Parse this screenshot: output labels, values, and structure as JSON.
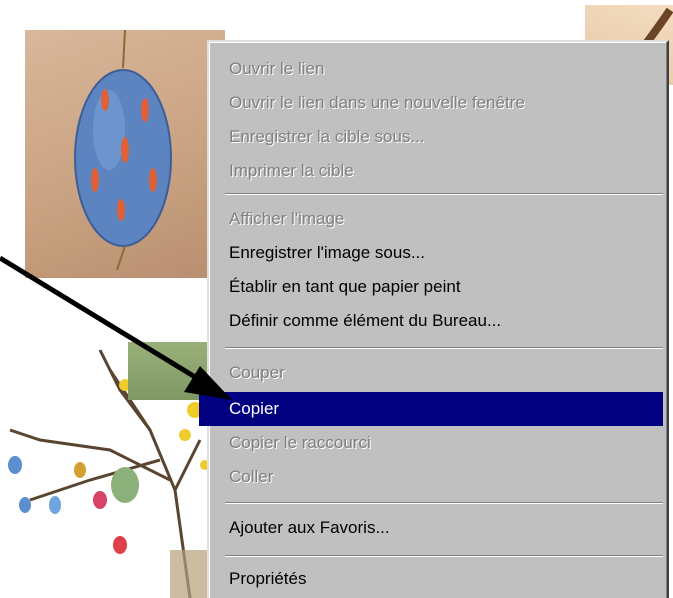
{
  "context_menu": {
    "groups": [
      [
        {
          "label": "Ouvrir le lien",
          "enabled": false
        },
        {
          "label": "Ouvrir le lien dans une nouvelle fenêtre",
          "enabled": false
        },
        {
          "label": "Enregistrer la cible sous...",
          "enabled": false
        },
        {
          "label": "Imprimer la cible",
          "enabled": false
        }
      ],
      [
        {
          "label": "Afficher l'image",
          "enabled": false
        },
        {
          "label": "Enregistrer l'image sous...",
          "enabled": true
        },
        {
          "label": "Établir en tant que papier peint",
          "enabled": true
        },
        {
          "label": "Définir comme élément du Bureau...",
          "enabled": true
        }
      ],
      [
        {
          "label": "Couper",
          "enabled": false
        },
        {
          "label": "Copier",
          "enabled": true,
          "selected": true
        },
        {
          "label": "Copier le raccourci",
          "enabled": false
        },
        {
          "label": "Coller",
          "enabled": false
        }
      ],
      [
        {
          "label": "Ajouter aux Favoris...",
          "enabled": true
        }
      ],
      [
        {
          "label": "Propriétés",
          "enabled": true
        }
      ]
    ]
  },
  "colors": {
    "menu_background": "#c0c0c0",
    "selection": "#000080",
    "disabled_text": "#808080"
  },
  "icons": [
    "pointer-arrow-icon"
  ]
}
